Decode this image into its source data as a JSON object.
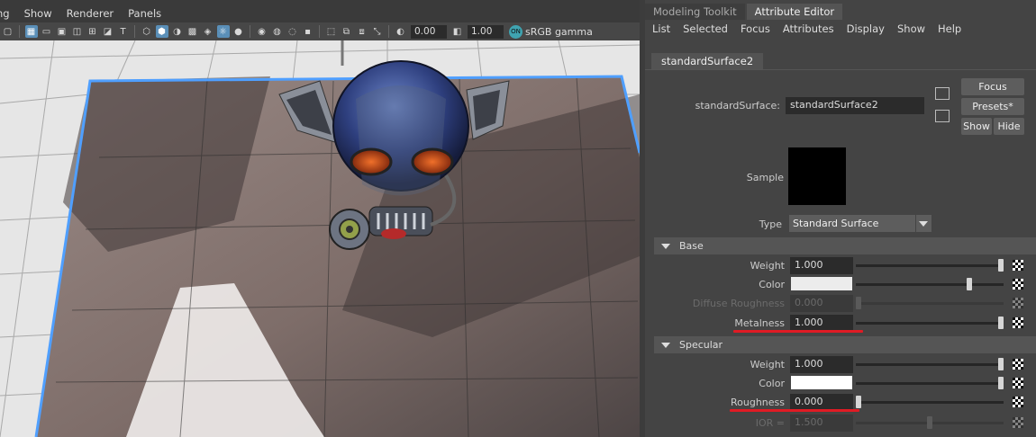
{
  "viewport": {
    "menu": [
      "ng",
      "Show",
      "Renderer",
      "Panels"
    ],
    "toolbar": {
      "exposure": "0.00",
      "gamma": "1.00",
      "colorspace": "sRGB gamma",
      "colorspace_badge": "ON"
    }
  },
  "ae": {
    "tabs": [
      "Modeling Toolkit",
      "Attribute Editor"
    ],
    "menu": [
      "List",
      "Selected",
      "Focus",
      "Attributes",
      "Display",
      "Show",
      "Help"
    ],
    "node_tab": "standardSurface2",
    "node_type_label": "standardSurface:",
    "node_name": "standardSurface2",
    "buttons": {
      "focus": "Focus",
      "presets": "Presets*",
      "show": "Show",
      "hide": "Hide"
    },
    "sample_label": "Sample",
    "type_label": "Type",
    "type_value": "Standard Surface",
    "base": {
      "title": "Base",
      "weight_label": "Weight",
      "weight_value": "1.000",
      "weight_pos": 1.0,
      "color_label": "Color",
      "color_swatch": "#ececec",
      "color_pos": 0.78,
      "diffuse_label": "Diffuse Roughness",
      "diffuse_value": "0.000",
      "diffuse_pos": 0.0,
      "metalness_label": "Metalness",
      "metalness_value": "1.000",
      "metalness_pos": 1.0
    },
    "specular": {
      "title": "Specular",
      "weight_label": "Weight",
      "weight_value": "1.000",
      "weight_pos": 1.0,
      "color_label": "Color",
      "color_swatch": "#ffffff",
      "color_pos": 1.0,
      "roughness_label": "Roughness",
      "roughness_value": "0.000",
      "roughness_pos": 0.0,
      "ior_label": "IOR =",
      "ior_value": "1.500",
      "ior_pos": 0.5
    },
    "highlight_color": "#e01b24"
  }
}
